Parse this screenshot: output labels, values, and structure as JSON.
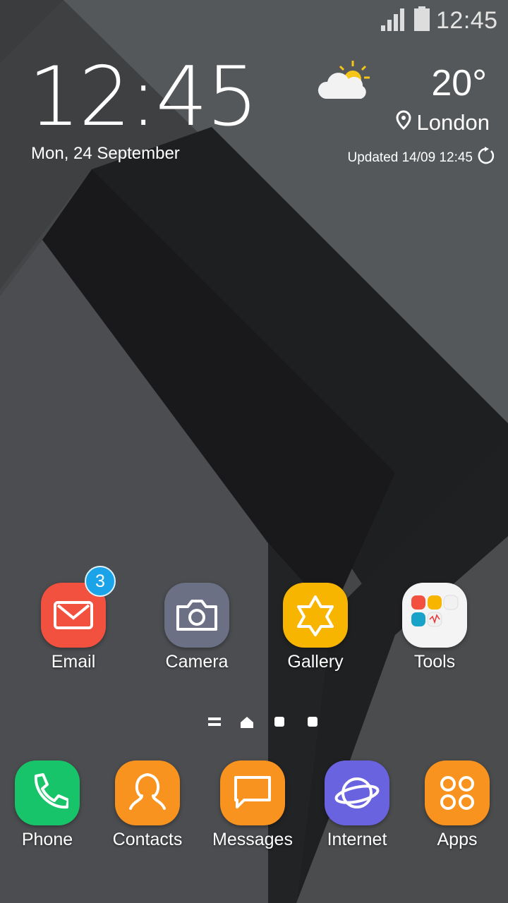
{
  "status_bar": {
    "time": "12:45",
    "signal_icon": "signal-icon",
    "battery_icon": "battery-icon"
  },
  "clock": {
    "time": "12:45",
    "date": "Mon, 24 September"
  },
  "weather": {
    "temperature": "20°",
    "location": "London",
    "updated": "Updated 14/09 12:45",
    "icon": "partly-sunny-icon",
    "refresh_icon": "refresh-icon"
  },
  "home_apps": [
    {
      "label": "Email",
      "icon": "email-icon",
      "color": "#f2513f",
      "badge": "3"
    },
    {
      "label": "Camera",
      "icon": "camera-icon",
      "color": "#6b7084"
    },
    {
      "label": "Gallery",
      "icon": "gallery-icon",
      "color": "#f7b500"
    },
    {
      "label": "Tools",
      "icon": "folder-icon",
      "color": "#f4f4f4"
    }
  ],
  "page_indicator": {
    "pages": [
      "menu-icon",
      "home-icon",
      "page-dot",
      "page-dot"
    ]
  },
  "dock": [
    {
      "label": "Phone",
      "icon": "phone-icon",
      "color": "#18c46a"
    },
    {
      "label": "Contacts",
      "icon": "contacts-icon",
      "color": "#f7931e"
    },
    {
      "label": "Messages",
      "icon": "messages-icon",
      "color": "#f7931e"
    },
    {
      "label": "Internet",
      "icon": "internet-icon",
      "color": "#6a63e0"
    },
    {
      "label": "Apps",
      "icon": "apps-icon",
      "color": "#f7931e"
    }
  ]
}
